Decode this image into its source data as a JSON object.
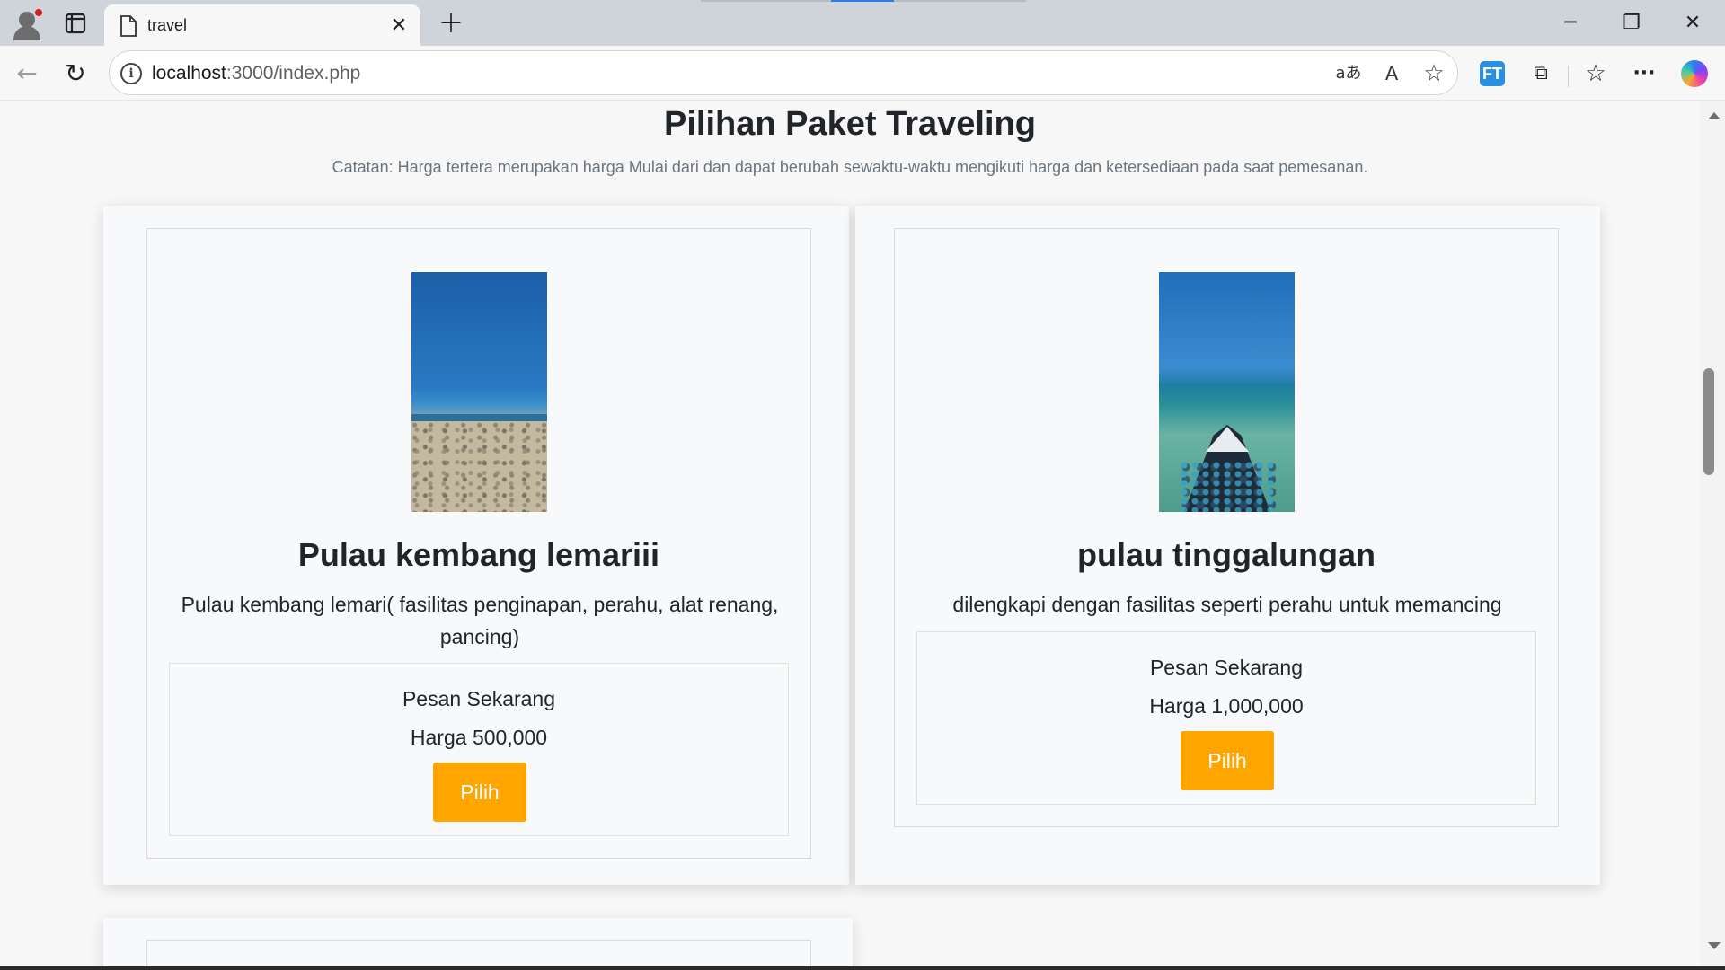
{
  "browser": {
    "tab_title": "travel",
    "tab_close": "✕",
    "new_tab": "+",
    "url_host": "localhost",
    "url_rest": ":3000/index.php",
    "window_controls": {
      "minimize": "─",
      "restore": "❐",
      "close": "✕"
    },
    "icons": {
      "back": "←",
      "reload": "↻",
      "info": "i",
      "translate": "aあ",
      "read_aloud": "A",
      "favorite": "☆",
      "extension_ft": "FT",
      "extensions": "⧉",
      "favorites": "☆",
      "more": "···"
    }
  },
  "page": {
    "title": "Pilihan Paket Traveling",
    "note": "Catatan: Harga tertera merupakan harga Mulai dari dan dapat berubah sewaktu-waktu mengikuti harga dan ketersediaan pada saat pemesanan."
  },
  "packages": [
    {
      "name": "Pulau kembang lemariii",
      "description": "Pulau kembang lemari( fasilitas penginapan, perahu, alat renang, pancing)",
      "order_label": "Pesan Sekarang",
      "price_text": "Harga 500,000",
      "button": "Pilih"
    },
    {
      "name": "pulau tinggalungan",
      "description": "dilengkapi dengan fasilitas seperti perahu untuk memancing",
      "order_label": "Pesan Sekarang",
      "price_text": "Harga 1,000,000",
      "button": "Pilih"
    }
  ],
  "colors": {
    "accent_button": "#ffa500",
    "page_bg": "#f7f7f7",
    "tabbar_bg": "#cfd4da"
  }
}
